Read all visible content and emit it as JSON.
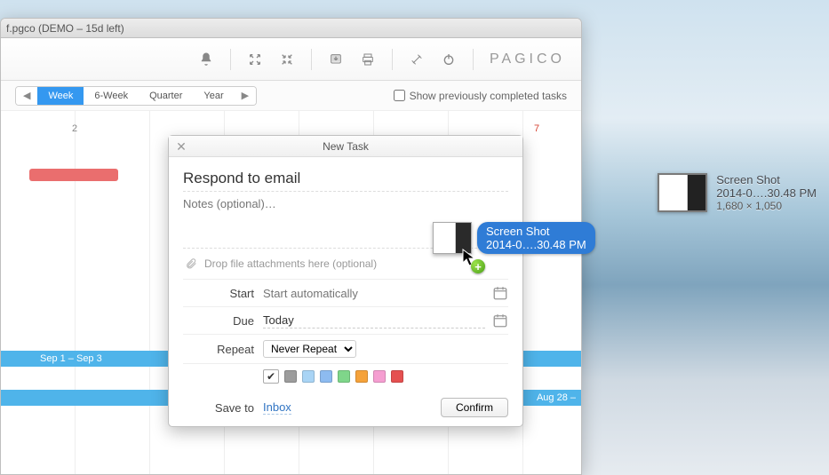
{
  "window": {
    "title": "f.pgco (DEMO – 15d left)"
  },
  "brand": "PAGICO",
  "subbar": {
    "tabs": [
      "Week",
      "6-Week",
      "Quarter",
      "Year"
    ],
    "show_completed_label": "Show previously completed tasks"
  },
  "canvas": {
    "day2": "2",
    "day7": "7",
    "band1": "Sep 1 – Sep 3",
    "band2": "Aug 28 –"
  },
  "dialog": {
    "title": "New Task",
    "task_title": "Respond to email",
    "notes_placeholder": "Notes (optional)…",
    "attach_hint": "Drop file attachments here (optional)",
    "start_label": "Start",
    "start_value": "Start automatically",
    "due_label": "Due",
    "due_value": "Today",
    "repeat_label": "Repeat",
    "repeat_value": "Never Repeat",
    "saveto_label": "Save to",
    "saveto_value": "Inbox",
    "confirm_label": "Confirm",
    "colors": [
      "#9c9c9c",
      "#a9d4f5",
      "#8dbbf0",
      "#7fd68a",
      "#f5a23a",
      "#f59ed1",
      "#e55050"
    ]
  },
  "drag": {
    "line1": "Screen Shot",
    "line2": "2014-0….30.48 PM"
  },
  "desktop_file": {
    "line1": "Screen Shot",
    "line2": "2014-0….30.48 PM",
    "dims": "1,680 × 1,050"
  }
}
